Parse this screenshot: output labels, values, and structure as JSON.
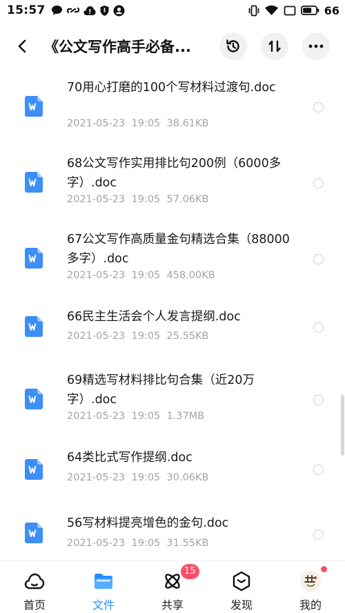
{
  "status_bar": {
    "time": "15:57",
    "battery_level": "66",
    "icons_left": [
      "chat-bubble-icon",
      "link-icon",
      "cloud-alert-icon",
      "shield-icon",
      "account-icon"
    ],
    "icons_right": [
      "vibrate-icon",
      "wifi-icon",
      "cast-icon",
      "battery-icon"
    ]
  },
  "header": {
    "title": "《公文写作高手必备...",
    "icons": [
      "back-arrow-icon",
      "history-icon",
      "sort-icon",
      "more-icon"
    ]
  },
  "files": [
    {
      "name": "70用心打磨的100个写材料过渡句.doc",
      "date": "2021-05-23",
      "time": "19:05",
      "size": "38.61KB",
      "selected": false
    },
    {
      "name": "68公文写作实用排比句200例（6000多字）.doc",
      "date": "2021-05-23",
      "time": "19:05",
      "size": "57.06KB",
      "selected": false
    },
    {
      "name": "67公文写作高质量金句精选合集（88000多字）.doc",
      "date": "2021-05-23",
      "time": "19:05",
      "size": "458.00KB",
      "selected": false
    },
    {
      "name": "66民主生活会个人发言提纲.doc",
      "date": "2021-05-23",
      "time": "19:05",
      "size": "25.55KB",
      "selected": false
    },
    {
      "name": "69精选写材料排比句合集（近20万字）.doc",
      "date": "2021-05-23",
      "time": "19:05",
      "size": "1.37MB",
      "selected": false
    },
    {
      "name": "64类比式写作提纲.doc",
      "date": "2021-05-23",
      "time": "19:05",
      "size": "30.06KB",
      "selected": false
    },
    {
      "name": "56写材料提亮增色的金句.doc",
      "date": "2021-05-23",
      "time": "19:05",
      "size": "31.55KB",
      "selected": false
    }
  ],
  "file_icon": "word-doc-icon",
  "colors": {
    "accent": "#1e90ff",
    "doc_icon": "#3d8ef5",
    "badge": "#ff4d67",
    "meta_text": "#a3a3a8"
  },
  "tabbar": {
    "tabs": [
      {
        "label": "首页",
        "icon": "cloud-home-icon",
        "active": false
      },
      {
        "label": "文件",
        "icon": "folder-icon",
        "active": true
      },
      {
        "label": "共享",
        "icon": "share-atom-icon",
        "active": false,
        "badge": "15"
      },
      {
        "label": "发现",
        "icon": "discover-cube-icon",
        "active": false
      },
      {
        "label": "我的",
        "icon": "avatar-icon",
        "active": false,
        "dot": true
      }
    ]
  }
}
